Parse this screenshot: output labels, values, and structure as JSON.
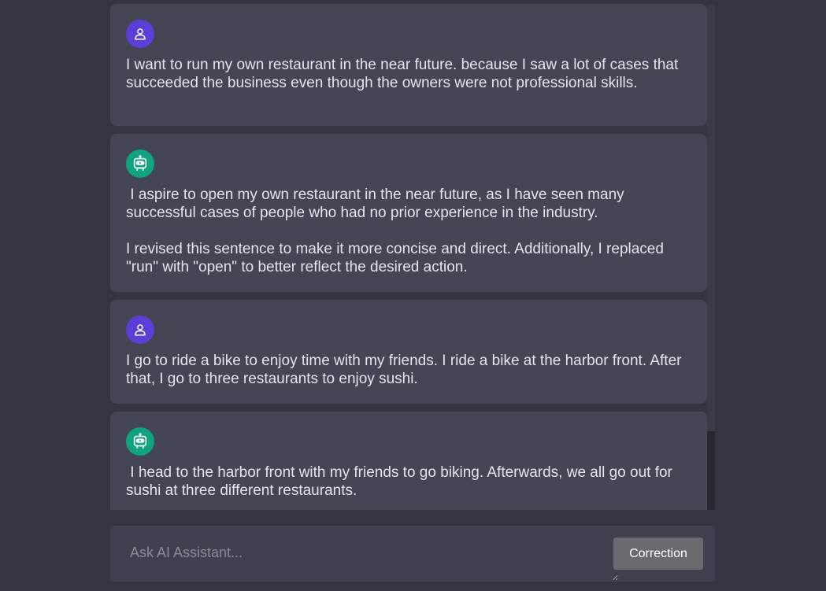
{
  "messages": [
    {
      "role": "user",
      "avatar_icon": "user-icon",
      "text": "I want to run my own restaurant in the near future. because I saw a lot of cases that succeeded the business even though the owners were not professional skills."
    },
    {
      "role": "assistant",
      "avatar_icon": "robot-icon",
      "text": " I aspire to open my own restaurant in the near future, as I have seen many successful cases of people who had no prior experience in the industry.\n\nI revised this sentence to make it more concise and direct. Additionally, I replaced \"run\" with \"open\" to better reflect the desired action."
    },
    {
      "role": "user",
      "avatar_icon": "user-icon",
      "text": "I go to ride a bike to enjoy time with my friends. I ride a bike at the harbor front. After that, I go to three restaurants to enjoy sushi."
    },
    {
      "role": "assistant",
      "avatar_icon": "robot-icon",
      "text": " I head to the harbor front with my friends to go biking. Afterwards, we all go out for sushi at three different restaurants."
    }
  ],
  "input": {
    "placeholder": "Ask AI Assistant...",
    "value": ""
  },
  "correction_button": {
    "label": "Correction"
  },
  "colors": {
    "background": "#343541",
    "message_bg": "#444654",
    "user_avatar": "#5b3fd8",
    "bot_avatar": "#10a37f",
    "button_bg": "#6b6b6f"
  }
}
